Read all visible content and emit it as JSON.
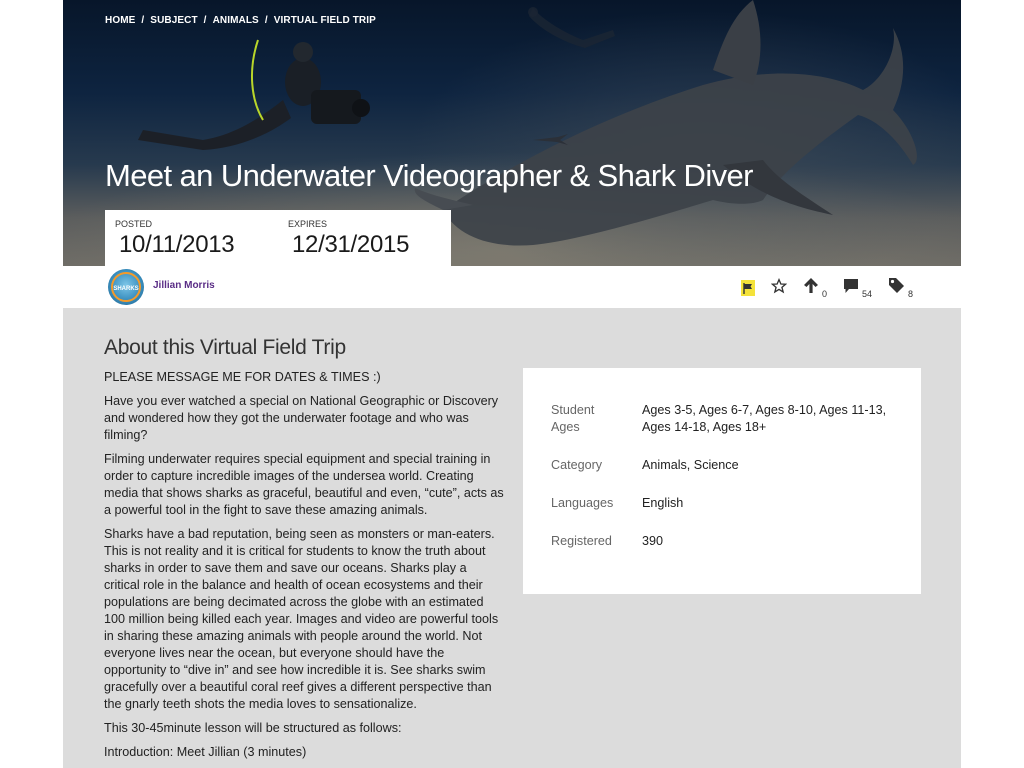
{
  "breadcrumb": [
    "HOME",
    "SUBJECT",
    "ANIMALS",
    "VIRTUAL FIELD TRIP"
  ],
  "breadcrumb_separator": "/",
  "title": "Meet an Underwater Videographer & Shark Diver",
  "dates": {
    "posted_label": "POSTED",
    "posted_value": "10/11/2013",
    "expires_label": "EXPIRES",
    "expires_value": "12/31/2015"
  },
  "author": {
    "name": "Jillian Morris",
    "avatar_text": "SHARKS"
  },
  "actions": {
    "flag_icon": "flag-icon",
    "flag_color": "#f4e23a",
    "favorite_icon": "star-icon",
    "upvote_icon": "arrow-up-icon",
    "upvote_count": "0",
    "comment_icon": "comment-icon",
    "comment_count": "54",
    "tag_icon": "tag-icon",
    "tag_count": "8"
  },
  "about": {
    "heading": "About this Virtual Field Trip",
    "paragraphs": [
      "PLEASE MESSAGE ME FOR DATES & TIMES :)",
      "Have you ever watched a special on National Geographic or Discovery and wondered how they got the underwater footage and who was filming?",
      "Filming underwater requires special equipment and special training in order to capture incredible images of the undersea world. Creating media that shows sharks as graceful, beautiful and even, “cute”, acts as a powerful tool in the fight to save these amazing animals.",
      "Sharks have a bad reputation, being seen as monsters or man-eaters. This is not reality and it is critical for students to know the truth about sharks in order to save them and save our oceans. Sharks play a critical role in the balance and health of ocean ecosystems and their populations are being decimated across the globe with an estimated 100 million being killed each year. Images and video are powerful tools in sharing these amazing animals with people around the world. Not everyone lives near the ocean, but everyone should have the opportunity to “dive in” and see how incredible it is. See sharks swim gracefully over a beautiful coral reef gives a different perspective than the gnarly teeth shots the media loves to sensationalize.",
      "This 30-45minute lesson will be structured as follows:",
      "Introduction: Meet Jillian (3 minutes)"
    ]
  },
  "info": [
    {
      "label": "Student Ages",
      "value": "Ages 3-5, Ages 6-7, Ages 8-10, Ages 11-13, Ages 14-18, Ages 18+"
    },
    {
      "label": "Category",
      "value": "Animals, Science"
    },
    {
      "label": "Languages",
      "value": "English"
    },
    {
      "label": "Registered",
      "value": "390"
    }
  ]
}
